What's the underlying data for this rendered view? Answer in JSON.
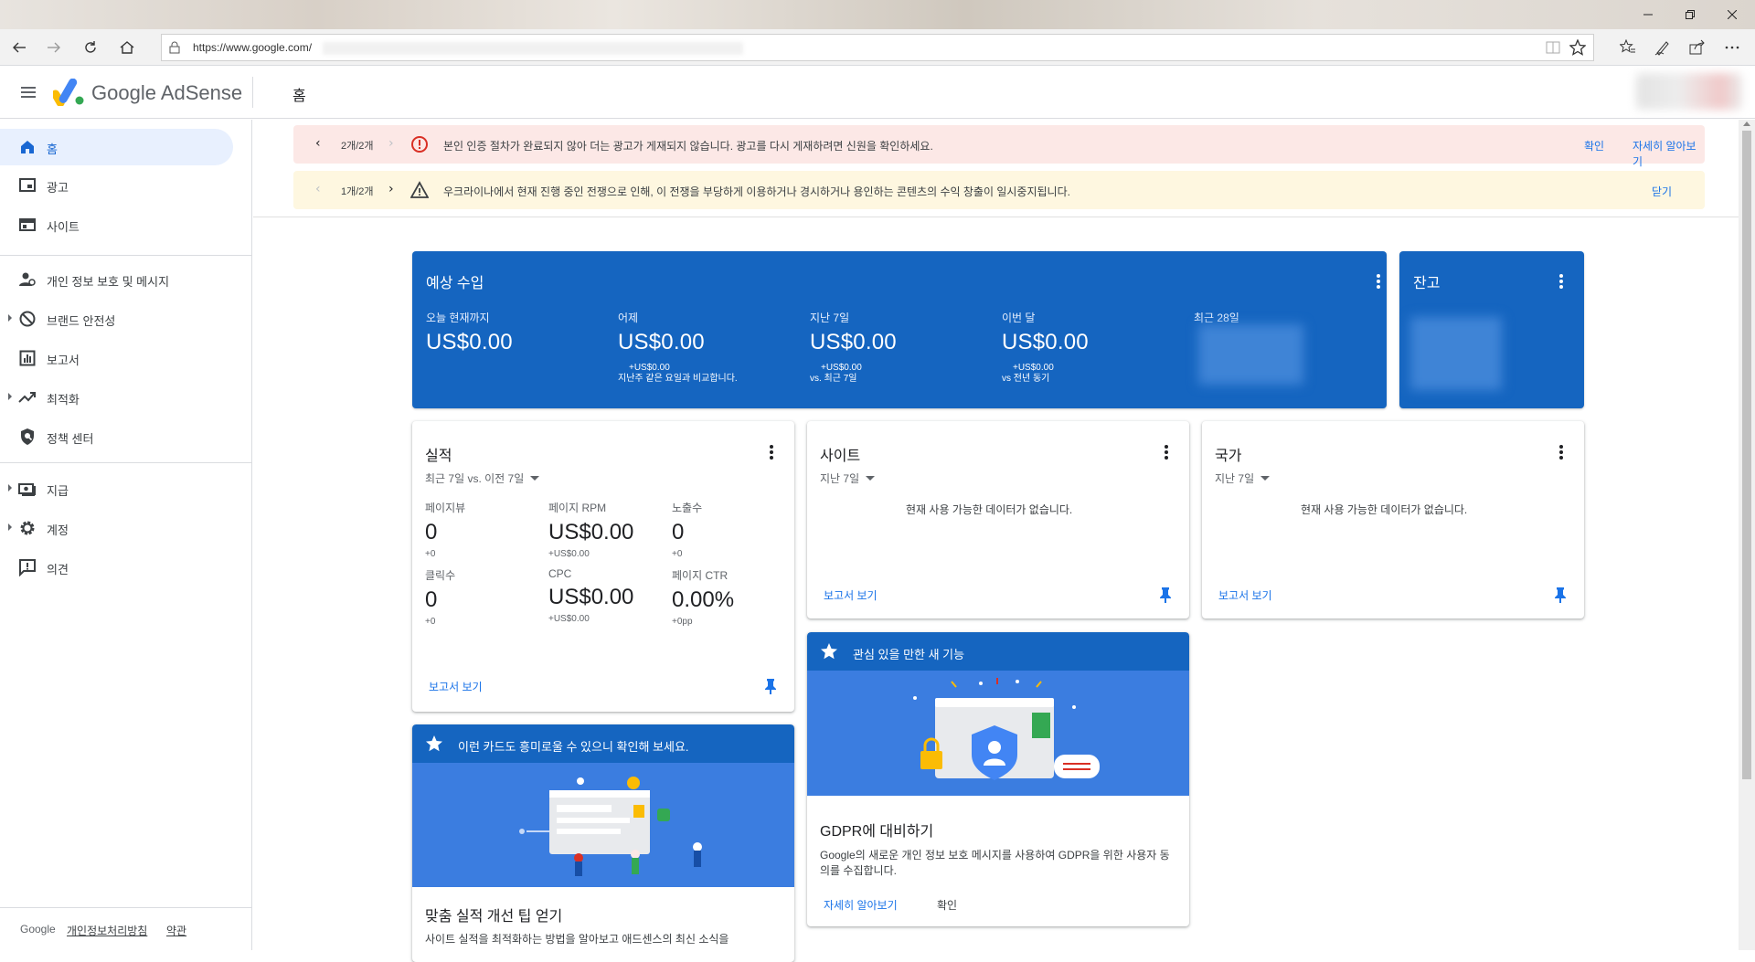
{
  "browser": {
    "url": "https://www.google.com/"
  },
  "app": {
    "brand": "Google AdSense",
    "page_title": "홈"
  },
  "sidebar": {
    "items": [
      {
        "label": "홈",
        "icon": "home-icon"
      },
      {
        "label": "광고",
        "icon": "ads-icon"
      },
      {
        "label": "사이트",
        "icon": "sites-icon"
      },
      {
        "label": "개인 정보 보호 및 메시지",
        "icon": "privacy-icon"
      },
      {
        "label": "브랜드 안전성",
        "icon": "block-icon"
      },
      {
        "label": "보고서",
        "icon": "report-icon"
      },
      {
        "label": "최적화",
        "icon": "trending-icon"
      },
      {
        "label": "정책 센터",
        "icon": "policy-icon"
      },
      {
        "label": "지급",
        "icon": "payments-icon"
      },
      {
        "label": "계정",
        "icon": "gear-icon"
      },
      {
        "label": "의견",
        "icon": "feedback-icon"
      }
    ],
    "footer": {
      "google": "Google",
      "privacy": "개인정보처리방침",
      "terms": "약관"
    }
  },
  "notices": {
    "error": {
      "counter": "2개/2개",
      "message": "본인 인증 절차가 완료되지 않아 더는 광고가 게재되지 않습니다. 광고를 다시 게재하려면 신원을 확인하세요.",
      "confirm": "확인",
      "learn_more": "자세히 알아보기"
    },
    "warning": {
      "counter": "1개/2개",
      "message": "우크라이나에서 현재 진행 중인 전쟁으로 인해, 이 전쟁을 부당하게 이용하거나 경시하거나 용인하는 콘텐츠의 수익 창출이 일시중지됩니다.",
      "close": "닫기"
    }
  },
  "earnings": {
    "title": "예상 수입",
    "columns": [
      {
        "label": "오늘 현재까지",
        "value": "US$0.00",
        "delta": "",
        "note": ""
      },
      {
        "label": "어제",
        "value": "US$0.00",
        "delta": "+US$0.00",
        "note": "지난주 같은 요일과 비교합니다."
      },
      {
        "label": "지난 7일",
        "value": "US$0.00",
        "delta": "+US$0.00",
        "note": "vs. 최근 7일"
      },
      {
        "label": "이번 달",
        "value": "US$0.00",
        "delta": "+US$0.00",
        "note": "vs 전년 동기"
      },
      {
        "label": "최근 28일",
        "value": "",
        "delta": "",
        "note": ""
      }
    ]
  },
  "balance": {
    "title": "잔고"
  },
  "performance": {
    "title": "실적",
    "range": "최근 7일 vs. 이전 7일",
    "metrics": [
      {
        "label": "페이지뷰",
        "value": "0",
        "delta": "+0"
      },
      {
        "label": "페이지 RPM",
        "value": "US$0.00",
        "delta": "+US$0.00"
      },
      {
        "label": "노출수",
        "value": "0",
        "delta": "+0"
      },
      {
        "label": "클릭수",
        "value": "0",
        "delta": "+0"
      },
      {
        "label": "CPC",
        "value": "US$0.00",
        "delta": "+US$0.00"
      },
      {
        "label": "페이지 CTR",
        "value": "0.00%",
        "delta": "+0pp"
      }
    ],
    "report_link": "보고서 보기"
  },
  "sites_card": {
    "title": "사이트",
    "range": "지난 7일",
    "empty": "현재 사용 가능한 데이터가 없습니다.",
    "report_link": "보고서 보기"
  },
  "countries_card": {
    "title": "국가",
    "range": "지난 7일",
    "empty": "현재 사용 가능한 데이터가 없습니다.",
    "report_link": "보고서 보기"
  },
  "promo_cards": {
    "interest": {
      "header": "이런 카드도 흥미로울 수 있으니 확인해 보세요.",
      "title": "맞춤 실적 개선 팁 얻기",
      "body": "사이트 실적을 최적화하는 방법을 알아보고 애드센스의 최신 소식을"
    },
    "new_features": {
      "header": "관심 있을 만한 새 기능",
      "title": "GDPR에 대비하기",
      "body": "Google의 새로운 개인 정보 보호 메시지를 사용하여 GDPR을 위한 사용자 동의를 수집합니다.",
      "learn_more": "자세히 알아보기",
      "confirm": "확인"
    }
  },
  "colors": {
    "accent": "#1a73e8",
    "card_blue": "#1565c0",
    "error_bg": "#fce8e6",
    "warn_bg": "#fef7e0"
  }
}
